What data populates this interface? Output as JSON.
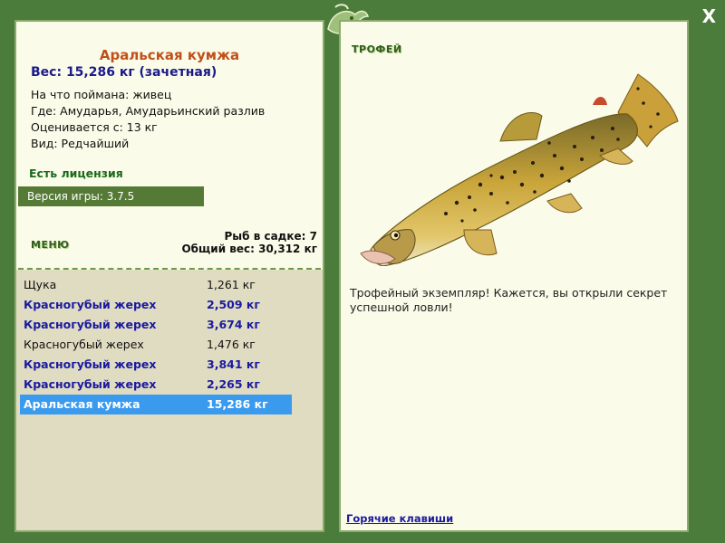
{
  "window": {
    "close_label": "X"
  },
  "fish": {
    "name": "Аральская кумжа",
    "weight_line": "Вес: 15,286 кг (зачетная)",
    "caught_on": "На что поймана: живец",
    "location": "Где: Амударья, Амударьинский разлив",
    "valued_from": "Оценивается с: 13 кг",
    "rarity": "Вид: Редчайший"
  },
  "license": "Есть лицензия",
  "version": "Версия игры: 3.7.5",
  "menu_label": "МЕНЮ",
  "cage": {
    "count_line": "Рыб в садке: 7",
    "total_line": "Общий вес: 30,312 кг"
  },
  "catch_list": [
    {
      "name": "Щука",
      "weight": "1,261 кг",
      "style": "normal"
    },
    {
      "name": "Красногубый жерех",
      "weight": "2,509 кг",
      "style": "bold"
    },
    {
      "name": "Красногубый жерех",
      "weight": "3,674 кг",
      "style": "bold"
    },
    {
      "name": "Красногубый жерех",
      "weight": "1,476 кг",
      "style": "normal"
    },
    {
      "name": "Красногубый жерех",
      "weight": "3,841 кг",
      "style": "bold"
    },
    {
      "name": "Красногубый жерех",
      "weight": "2,265 кг",
      "style": "bold"
    },
    {
      "name": "Аральская кумжа",
      "weight": "15,286 кг",
      "style": "selected"
    }
  ],
  "trophy": {
    "label": "ТРОФЕЙ",
    "text": "Трофейный экземпляр! Кажется, вы открыли секрет успешной ловли!"
  },
  "hotkeys_link": "Горячие клавиши",
  "colors": {
    "frame": "#4b7c3b",
    "panel": "#fbfbe9",
    "title": "#c0501a",
    "link_blue": "#1a1aa0",
    "selected_row": "#3a9aee",
    "version_bar": "#557a35"
  },
  "icons": {
    "logo": "fish-logo-icon"
  }
}
